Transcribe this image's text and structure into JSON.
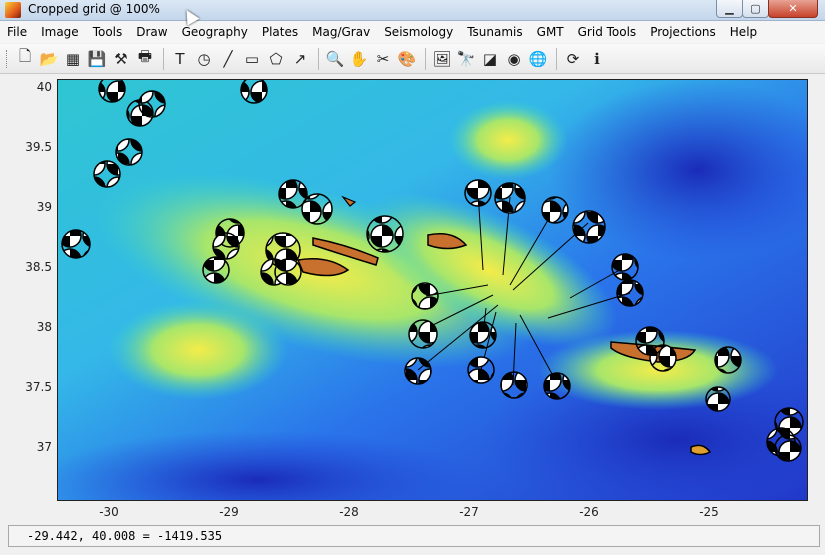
{
  "window": {
    "title": "Cropped grid  @  100%"
  },
  "menu": [
    "File",
    "Image",
    "Tools",
    "Draw",
    "Geography",
    "Plates",
    "Mag/Grav",
    "Seismology",
    "Tsunamis",
    "GMT",
    "Grid Tools",
    "Projections",
    "Help"
  ],
  "toolbar": [
    {
      "name": "new-file-icon",
      "glyph": "🗋"
    },
    {
      "name": "open-file-icon",
      "glyph": "📂"
    },
    {
      "name": "grid-icon",
      "glyph": "▦"
    },
    {
      "name": "save-icon",
      "glyph": "💾"
    },
    {
      "name": "tools-icon",
      "glyph": "⚒"
    },
    {
      "name": "print-icon",
      "glyph": "🖶"
    },
    {
      "sep": true
    },
    {
      "name": "text-icon",
      "glyph": "T"
    },
    {
      "name": "circle-icon",
      "glyph": "◷"
    },
    {
      "name": "line-icon",
      "glyph": "╱"
    },
    {
      "name": "rectangle-icon",
      "glyph": "▭"
    },
    {
      "name": "polygon-icon",
      "glyph": "⬠"
    },
    {
      "name": "arrow-icon",
      "glyph": "↗"
    },
    {
      "sep": true
    },
    {
      "name": "zoom-icon",
      "glyph": "🔍"
    },
    {
      "name": "pan-hand-icon",
      "glyph": "✋"
    },
    {
      "name": "scissors-icon",
      "glyph": "✂"
    },
    {
      "name": "palette-icon",
      "glyph": "🎨"
    },
    {
      "sep": true
    },
    {
      "name": "image-tool-icon",
      "glyph": "🖼"
    },
    {
      "name": "binoculars-icon",
      "glyph": "🔭"
    },
    {
      "name": "shade-icon",
      "glyph": "◪"
    },
    {
      "name": "sphere-icon",
      "glyph": "◉"
    },
    {
      "name": "globe-icon",
      "glyph": "🌐"
    },
    {
      "sep": true
    },
    {
      "name": "refresh-icon",
      "glyph": "⟳"
    },
    {
      "name": "info-icon",
      "glyph": "ℹ"
    }
  ],
  "axes": {
    "y_ticks": [
      "40",
      "39.5",
      "39",
      "38.5",
      "38",
      "37.5",
      "37"
    ],
    "x_ticks": [
      "-30",
      "-29",
      "-28",
      "-27",
      "-26",
      "-25"
    ]
  },
  "status": {
    "readout": "-29.442, 40.008 = -1419.535"
  },
  "colors": {
    "ocean_deep": "#2a3fd6",
    "ocean_mid": "#1f8ff0",
    "shallow": "#35d6c8",
    "ridge": "#e8e84a",
    "island": "#c8702e"
  }
}
